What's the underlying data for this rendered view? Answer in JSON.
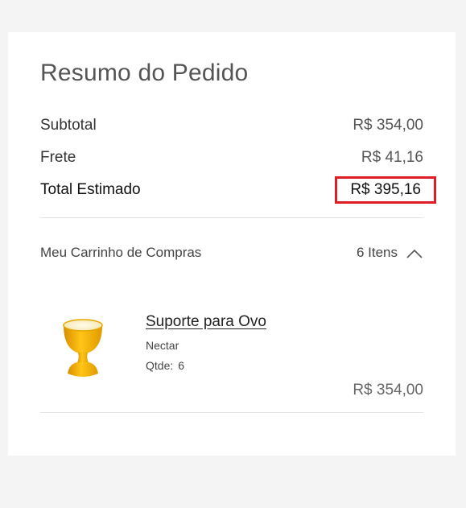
{
  "summary": {
    "title": "Resumo do Pedido",
    "subtotal_label": "Subtotal",
    "subtotal_value": "R$ 354,00",
    "shipping_label": "Frete",
    "shipping_value": "R$ 41,16",
    "total_label": "Total Estimado",
    "total_value": "R$ 395,16"
  },
  "cart": {
    "label": "Meu Carrinho de Compras",
    "count": "6 Itens",
    "toggle_icon": "chevron-up-icon",
    "items": [
      {
        "name": "Suporte para Ovo",
        "color": "Nectar",
        "qty_label": "Qtde:",
        "qty": "6",
        "price": "R$ 354,00",
        "image": "egg-cup-image"
      }
    ]
  },
  "colors": {
    "highlight_border": "#e01b24",
    "product_yellow": "#f2b705",
    "background": "#f4f4f4"
  }
}
